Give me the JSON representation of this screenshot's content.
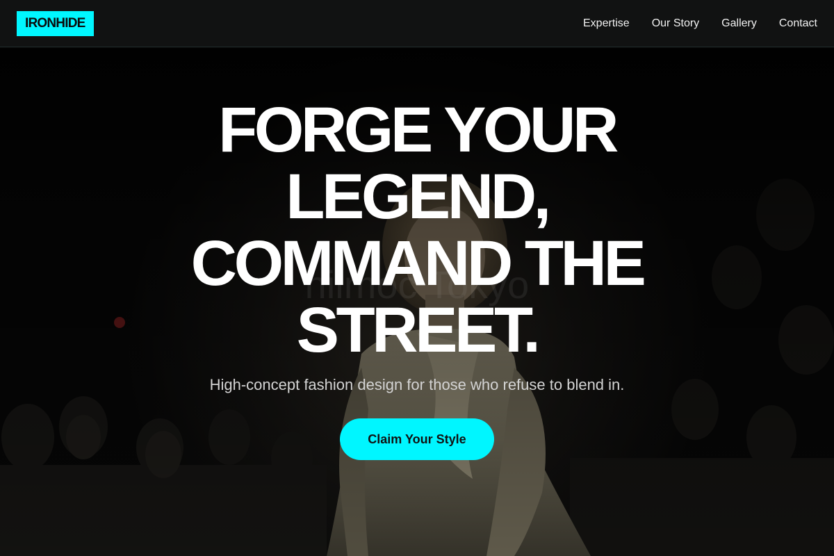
{
  "brand": {
    "logo_text": "IRONHIDE",
    "accent_color": "#00f6ff"
  },
  "nav": {
    "items": [
      {
        "label": "Expertise"
      },
      {
        "label": "Our Story"
      },
      {
        "label": "Gallery"
      },
      {
        "label": "Contact"
      }
    ]
  },
  "hero": {
    "headline": "FORGE YOUR LEGEND, COMMAND THE STREET.",
    "subheadline": "High-concept fashion design for those who refuse to blend in.",
    "cta_label": "Claim Your Style",
    "background_image": "runway-model-photo"
  }
}
